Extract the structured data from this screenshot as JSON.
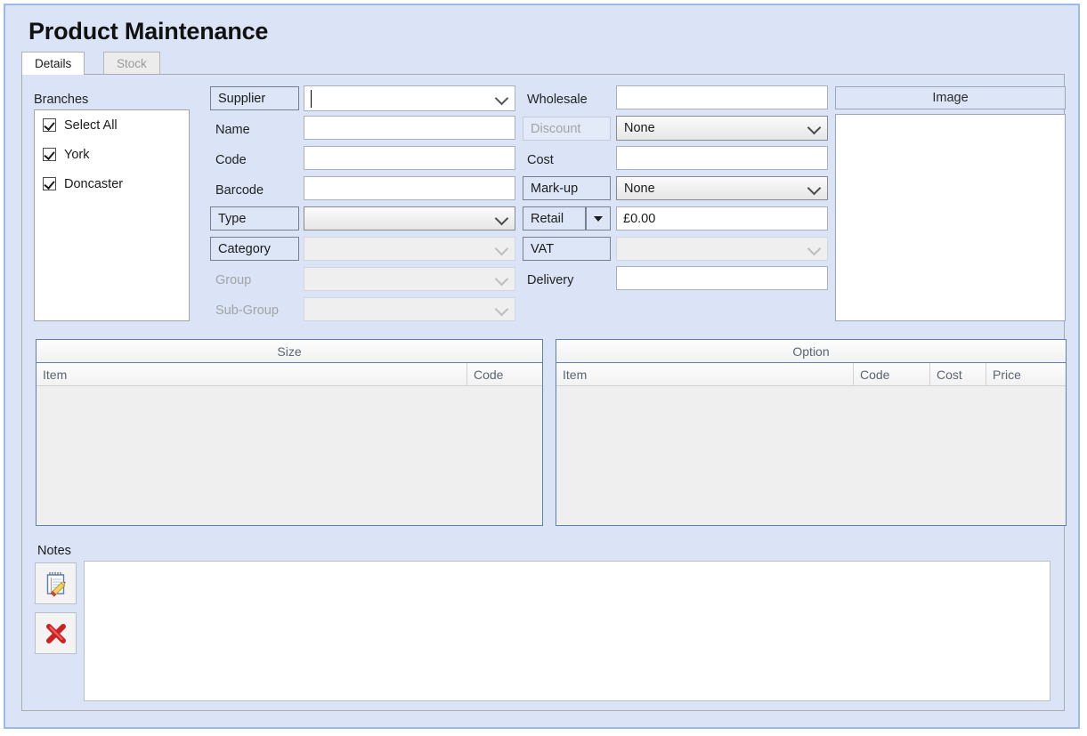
{
  "window": {
    "title": "Product Maintenance"
  },
  "tabs": [
    {
      "label": "Details",
      "active": true
    },
    {
      "label": "Stock",
      "active": false
    }
  ],
  "branches": {
    "label": "Branches",
    "items": [
      {
        "label": "Select All",
        "checked": true
      },
      {
        "label": "York",
        "checked": true
      },
      {
        "label": "Doncaster",
        "checked": true
      }
    ]
  },
  "form_left": {
    "supplier": {
      "label": "Supplier",
      "value": "",
      "type": "combobox",
      "enabled": true,
      "boxed_label": true
    },
    "name": {
      "label": "Name",
      "value": "",
      "type": "text",
      "enabled": true
    },
    "code": {
      "label": "Code",
      "value": "",
      "type": "text",
      "enabled": true
    },
    "barcode": {
      "label": "Barcode",
      "value": "",
      "type": "text",
      "enabled": true
    },
    "type": {
      "label": "Type",
      "value": "",
      "type": "combobox",
      "enabled": true,
      "boxed_label": true
    },
    "category": {
      "label": "Category",
      "value": "",
      "type": "combobox",
      "enabled": false,
      "boxed_label": true
    },
    "group": {
      "label": "Group",
      "value": "",
      "type": "combobox",
      "enabled": false,
      "boxed_label": false
    },
    "subgroup": {
      "label": "Sub-Group",
      "value": "",
      "type": "combobox",
      "enabled": false,
      "boxed_label": false
    }
  },
  "form_right": {
    "wholesale": {
      "label": "Wholesale",
      "value": "",
      "type": "text",
      "enabled": true
    },
    "discount": {
      "label": "Discount",
      "value": "None",
      "type": "combobox",
      "enabled": true,
      "label_disabled": true
    },
    "cost": {
      "label": "Cost",
      "value": "",
      "type": "text",
      "enabled": true
    },
    "markup": {
      "label": "Mark-up",
      "value": "None",
      "type": "combobox",
      "enabled": true
    },
    "retail": {
      "label": "Retail",
      "value": "£0.00",
      "type": "text",
      "enabled": true,
      "split_button": true
    },
    "vat": {
      "label": "VAT",
      "value": "",
      "type": "combobox",
      "enabled": false
    },
    "delivery": {
      "label": "Delivery",
      "value": "",
      "type": "text",
      "enabled": true
    }
  },
  "image_panel": {
    "header": "Image"
  },
  "size_grid": {
    "title": "Size",
    "columns": [
      "Item",
      "Code"
    ],
    "rows": []
  },
  "option_grid": {
    "title": "Option",
    "columns": [
      "Item",
      "Code",
      "Cost",
      "Price"
    ],
    "rows": []
  },
  "notes": {
    "label": "Notes",
    "value": "",
    "edit_icon": "notepad-pencil-icon",
    "delete_icon": "red-cross-icon"
  },
  "colors": {
    "window_background": "#dae4f6",
    "window_border": "#9bbbe4",
    "field_border": "#aab1bd",
    "grid_border": "#5e80a8",
    "grid_body": "#efefef",
    "label_box": "#dce6f7",
    "disabled_text": "#a3a3a3",
    "delete_icon": "#cc2222"
  }
}
